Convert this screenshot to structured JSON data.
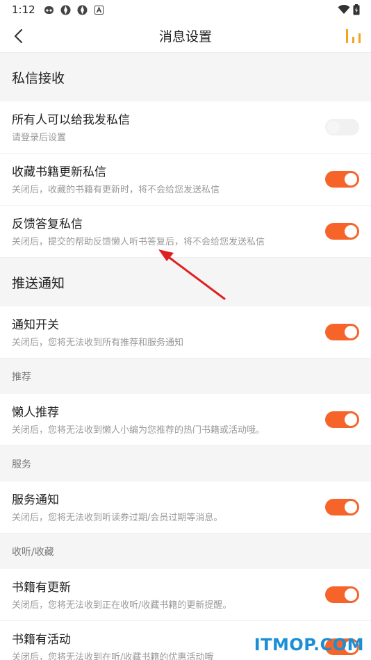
{
  "status_bar": {
    "time": "1:12"
  },
  "header": {
    "title": "消息设置"
  },
  "sections": {
    "private_messages": {
      "title": "私信接收",
      "rows": [
        {
          "title": "所有人可以给我发私信",
          "subtitle": "请登录后设置",
          "enabled": false,
          "disabled": true
        },
        {
          "title": "收藏书籍更新私信",
          "subtitle": "关闭后，收藏的书籍有更新时，将不会给您发送私信",
          "enabled": true
        },
        {
          "title": "反馈答复私信",
          "subtitle": "关闭后，提交的帮助反馈懒人听书答复后，将不会给您发送私信",
          "enabled": true
        }
      ]
    },
    "push": {
      "title": "推送通知",
      "main_row": {
        "title": "通知开关",
        "subtitle": "关闭后，您将无法收到所有推荐和服务通知",
        "enabled": true
      },
      "groups": [
        {
          "label": "推荐",
          "row": {
            "title": "懒人推荐",
            "subtitle": "关闭后，您将无法收到懒人小编为您推荐的热门书籍或活动哦。",
            "enabled": true
          }
        },
        {
          "label": "服务",
          "row": {
            "title": "服务通知",
            "subtitle": "关闭后，您将无法收到听读券过期/会员过期等消息。",
            "enabled": true
          }
        },
        {
          "label": "收听/收藏",
          "row": {
            "title": "书籍有更新",
            "subtitle": "关闭后，您将无法收到正在收听/收藏书籍的更新提醒。",
            "enabled": true
          }
        }
      ],
      "last_row": {
        "title": "书籍有活动",
        "subtitle": "关闭后，您将无法收到在听/收藏书籍的优惠活动哦",
        "enabled": true
      }
    }
  },
  "colors": {
    "accent": "#f7642a",
    "annotation_arrow": "#e02020",
    "watermark": "#1a8fd6"
  },
  "watermark": "ITMOP.COM"
}
